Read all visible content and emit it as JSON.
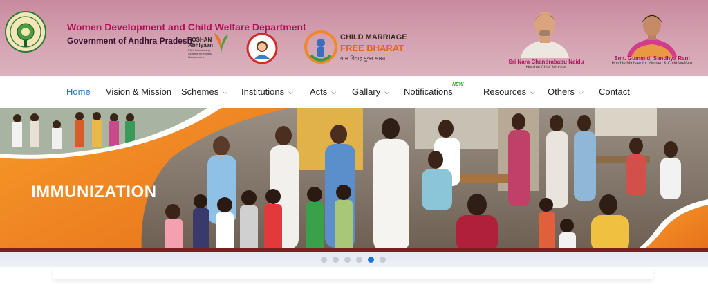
{
  "header": {
    "department_title": "Women Development and Child Welfare Department",
    "department_subtitle": "Government of Andhra Pradesh",
    "emblem_icon": "andhra-pradesh-emblem-icon",
    "poshan_logo": {
      "line1": "POSHAN",
      "line2": "Abhiyaan",
      "line3": "PM's Overarching",
      "line4": "Scheme for Holistic",
      "line5": "Nourishment"
    },
    "girl_logo_icon": "girl-child-logo-icon",
    "child_marriage_logo": {
      "line1": "CHILD MARRIAGE",
      "line2": "FREE BHARAT",
      "line3": "बाल विवाह मुक्त भारत"
    },
    "officials": [
      {
        "name": "Sri Nara Chandrababu Naidu",
        "role": "Hon'ble Chief Minister"
      },
      {
        "name": "Smt. Gummidi Sandhya Rani",
        "role": "Hon'ble Minister for Women & Child Welfare"
      }
    ]
  },
  "nav": {
    "items": [
      {
        "label": "Home",
        "active": true,
        "dropdown": false
      },
      {
        "label": "Vision & Mission",
        "dropdown": false
      },
      {
        "label": "Schemes",
        "dropdown": true
      },
      {
        "label": "Institutions",
        "dropdown": true
      },
      {
        "label": "Acts",
        "dropdown": true
      },
      {
        "label": "Gallary",
        "dropdown": true
      },
      {
        "label": "Notifications",
        "dropdown": false,
        "badge": "NEW"
      },
      {
        "label": "Resources",
        "dropdown": true
      },
      {
        "label": "Others",
        "dropdown": true
      },
      {
        "label": "Contact",
        "dropdown": false
      }
    ]
  },
  "banner": {
    "caption": "IMMUNIZATION",
    "slide_count": 6,
    "active_slide": 5
  },
  "colors": {
    "header_bg": "#d4a3b2",
    "title": "#b0105a",
    "nav_active": "#2a6fb0",
    "banner_orange": "#f08a1c",
    "dot_active": "#1a73d9"
  }
}
